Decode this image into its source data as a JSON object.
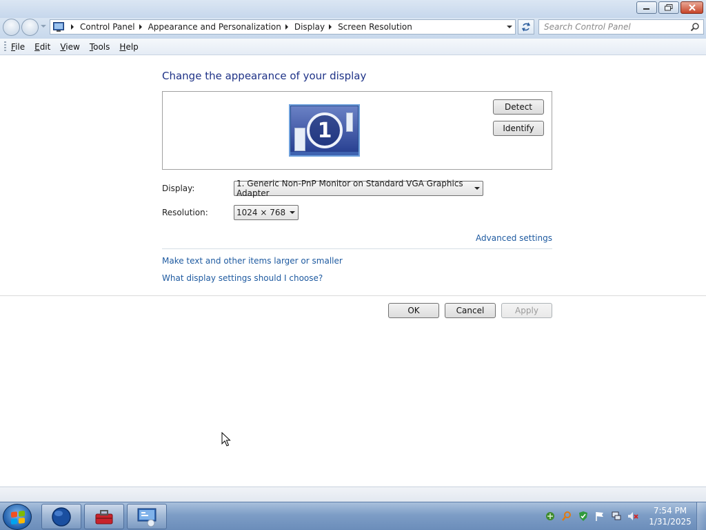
{
  "window": {
    "minimize_icon": "minimize-icon",
    "maximize_icon": "restore-icon",
    "close_icon": "close-icon"
  },
  "navbar": {
    "breadcrumbs": [
      {
        "label": "Control Panel"
      },
      {
        "label": "Appearance and Personalization"
      },
      {
        "label": "Display"
      },
      {
        "label": "Screen Resolution"
      }
    ],
    "search_placeholder": "Search Control Panel"
  },
  "menu": {
    "items": [
      {
        "first": "F",
        "rest": "ile"
      },
      {
        "first": "E",
        "rest": "dit"
      },
      {
        "first": "V",
        "rest": "iew"
      },
      {
        "first": "T",
        "rest": "ools"
      },
      {
        "first": "H",
        "rest": "elp"
      }
    ]
  },
  "main": {
    "title": "Change the appearance of your display",
    "monitor_number": "1",
    "detect_button": "Detect",
    "identify_button": "Identify",
    "display_label": "Display:",
    "display_value": "1. Generic Non-PnP Monitor on Standard VGA Graphics Adapter",
    "resolution_label": "Resolution:",
    "resolution_value": "1024 × 768",
    "advanced_link": "Advanced settings",
    "text_size_link": "Make text and other items larger or smaller",
    "choose_link": "What display settings should I choose?",
    "ok_button": "OK",
    "cancel_button": "Cancel",
    "apply_button": "Apply"
  },
  "taskbar": {
    "time": "7:54 PM",
    "date": "1/31/2025",
    "apps": [
      "internet-explorer-icon",
      "toolbox-icon",
      "control-panel-icon"
    ]
  },
  "colors": {
    "title_text": "#1e3287",
    "link": "#1e5aa0",
    "taskbar": "#7d9dc6"
  }
}
